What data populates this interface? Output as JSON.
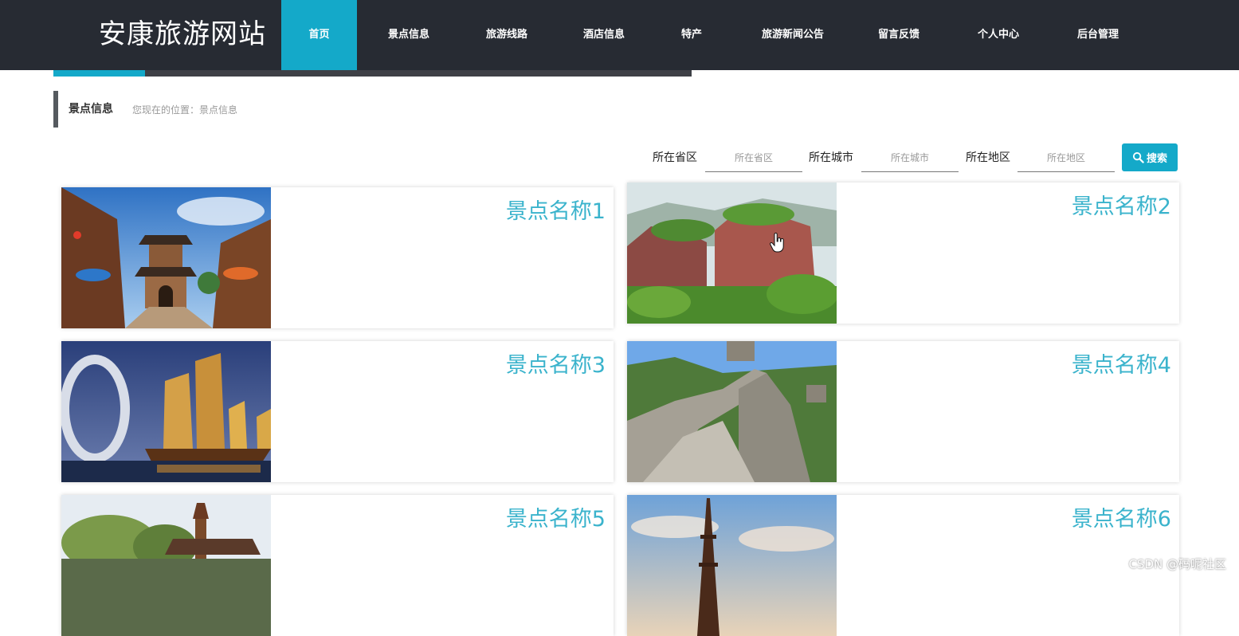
{
  "site": {
    "logo": "安康旅游网站"
  },
  "nav": [
    {
      "label": "首页",
      "active": true
    },
    {
      "label": "景点信息"
    },
    {
      "label": "旅游线路"
    },
    {
      "label": "酒店信息"
    },
    {
      "label": "特产"
    },
    {
      "label": "旅游新闻公告"
    },
    {
      "label": "留言反馈"
    },
    {
      "label": "个人中心"
    },
    {
      "label": "后台管理"
    }
  ],
  "breadcrumb": {
    "title": "景点信息",
    "path": "您现在的位置：景点信息"
  },
  "search": {
    "province_label": "所在省区",
    "province_placeholder": "所在省区",
    "province_value": "",
    "city_label": "所在城市",
    "city_placeholder": "所在城市",
    "city_value": "",
    "district_label": "所在地区",
    "district_placeholder": "所在地区",
    "district_value": "",
    "button_label": "搜索",
    "button_icon": "search-icon"
  },
  "spots": [
    {
      "name": "景点名称1",
      "image": "ancient-town-gate-photo"
    },
    {
      "name": "景点名称2",
      "image": "red-rock-mountain-photo"
    },
    {
      "name": "景点名称3",
      "image": "sailboats-ring-building-photo"
    },
    {
      "name": "景点名称4",
      "image": "great-wall-photo"
    },
    {
      "name": "景点名称5",
      "image": "pagoda-willow-photo"
    },
    {
      "name": "景点名称6",
      "image": "eiffel-tower-photo"
    }
  ],
  "watermark": "CSDN @码呢社区",
  "colors": {
    "accent": "#14a9c9",
    "header_bg": "#272b33",
    "spot_name": "#3ab3cc"
  }
}
